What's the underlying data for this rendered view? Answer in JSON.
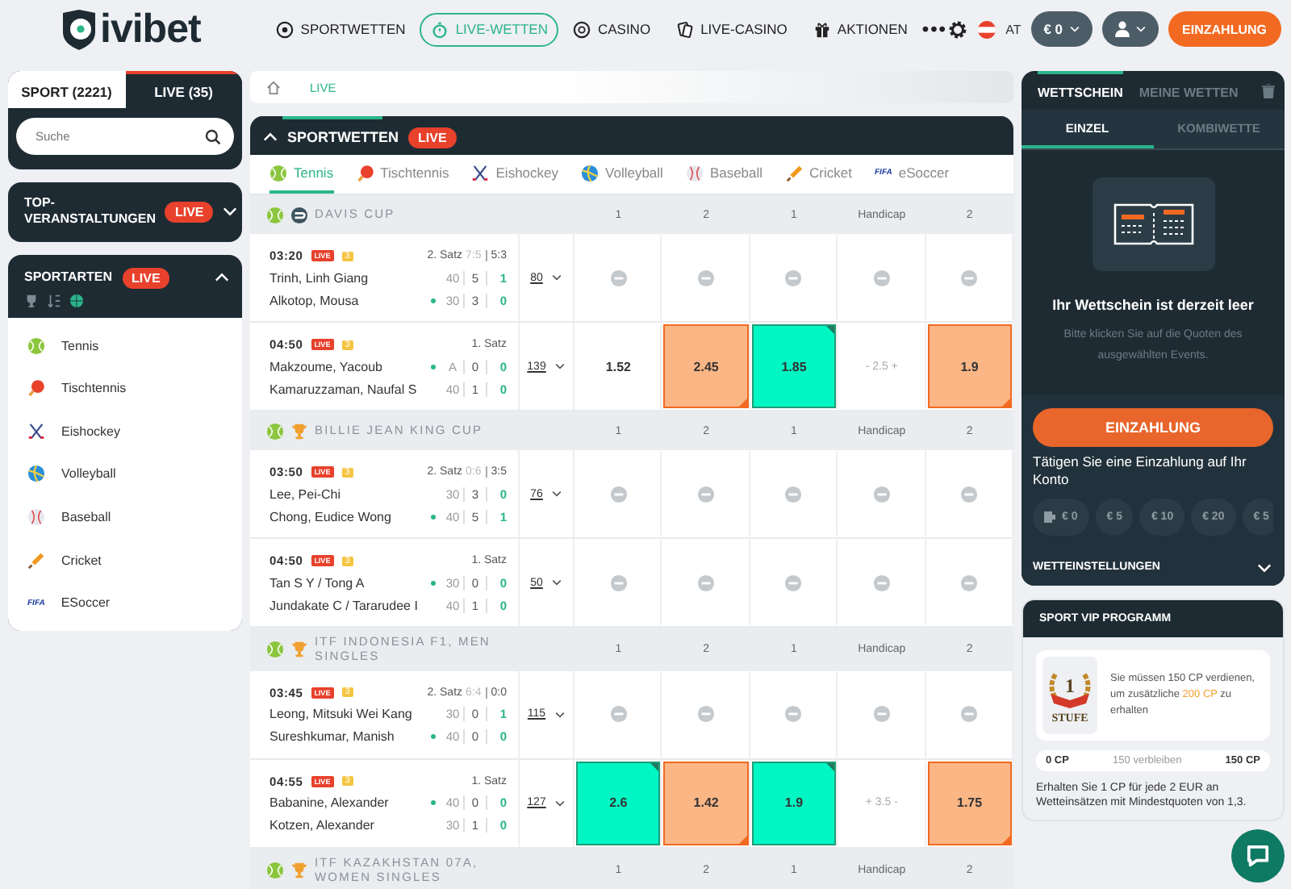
{
  "header": {
    "logo": "ivibet",
    "nav": [
      {
        "label": "SPORTWETTEN",
        "kind": "ball",
        "selected": false
      },
      {
        "label": "LIVE-WETTEN",
        "kind": "live",
        "selected": true
      },
      {
        "label": "CASINO",
        "kind": "chip",
        "selected": false
      },
      {
        "label": "LIVE-CASINO",
        "kind": "cards",
        "selected": false
      },
      {
        "label": "AKTIONEN",
        "kind": "gift",
        "selected": false
      }
    ],
    "more": "•••",
    "country": "AT",
    "balance": "€ 0",
    "deposit": "EINZAHLUNG"
  },
  "left": {
    "tabs": [
      {
        "label": "SPORT (2221)",
        "selected": false
      },
      {
        "label": "LIVE (35)",
        "selected": true
      }
    ],
    "search": {
      "placeholder": "Suche"
    },
    "top_events": {
      "title": "TOP-VERANSTALTUNGEN",
      "badge": "LIVE",
      "expanded": false
    },
    "sports": {
      "title": "SPORTARTEN",
      "badge": "LIVE",
      "expanded": true,
      "items": [
        {
          "label": "Tennis",
          "kind": "tennis"
        },
        {
          "label": "Tischtennis",
          "kind": "tabletennis"
        },
        {
          "label": "Eishockey",
          "kind": "hockey"
        },
        {
          "label": "Volleyball",
          "kind": "volleyball"
        },
        {
          "label": "Baseball",
          "kind": "baseball"
        },
        {
          "label": "Cricket",
          "kind": "cricket"
        },
        {
          "label": "ESoccer",
          "kind": "esoccer",
          "logo": "FIFA"
        }
      ]
    }
  },
  "breadcrumb": [
    "LIVE"
  ],
  "main": {
    "title": "SPORTWETTEN",
    "badge": "LIVE",
    "expanded": true,
    "tabs": [
      {
        "label": "Tennis",
        "kind": "tennis",
        "selected": true
      },
      {
        "label": "Tischtennis",
        "kind": "tabletennis",
        "selected": false
      },
      {
        "label": "Eishockey",
        "kind": "hockey",
        "selected": false
      },
      {
        "label": "Volleyball",
        "kind": "volleyball",
        "selected": false
      },
      {
        "label": "Baseball",
        "kind": "baseball",
        "selected": false
      },
      {
        "label": "Cricket",
        "kind": "cricket",
        "selected": false
      },
      {
        "label": "eSoccer",
        "kind": "esoccer",
        "logo": "FIFA",
        "selected": false
      }
    ],
    "leagues": [
      {
        "name": "DAVIS CUP",
        "kind": "round",
        "columns": [
          "1",
          "2",
          "1",
          "Handicap",
          "2"
        ],
        "matches": [
          {
            "time": "03:20",
            "live": "LIVE",
            "set_badge": "3",
            "period": "2. Satz",
            "previous_sets": "7:5",
            "current_set": "5:3",
            "markets": "80",
            "players": [
              {
                "name": "Trinh, Linh Giang",
                "serving": false,
                "points": "40",
                "games": "5",
                "sets": "1"
              },
              {
                "name": "Alkotop, Mousa",
                "serving": true,
                "points": "30",
                "games": "3",
                "sets": "0"
              }
            ],
            "odds": [
              {
                "kind": "locked"
              },
              {
                "kind": "locked"
              },
              {
                "kind": "locked"
              },
              {
                "kind": "locked"
              },
              {
                "kind": "locked"
              }
            ]
          },
          {
            "time": "04:50",
            "live": "LIVE",
            "set_badge": "3",
            "period": "1. Satz",
            "markets": "139",
            "players": [
              {
                "name": "Makzoume, Yacoub",
                "serving": true,
                "points": "A",
                "games": "0",
                "sets": "0"
              },
              {
                "name": "Kamaruzzaman, Naufal S",
                "serving": false,
                "points": "40",
                "games": "1",
                "sets": "0"
              }
            ],
            "odds": [
              {
                "kind": "odds",
                "value": "1.52",
                "rising": false,
                "falling": false
              },
              {
                "kind": "odds",
                "value": "2.45",
                "rising": false,
                "falling": true
              },
              {
                "kind": "odds",
                "value": "1.85",
                "rising": true,
                "falling": false
              },
              {
                "kind": "handicap",
                "value": "- 2.5 +"
              },
              {
                "kind": "odds",
                "value": "1.9",
                "rising": false,
                "falling": true
              }
            ]
          }
        ]
      },
      {
        "name": "BILLIE JEAN KING CUP",
        "kind": "trophy",
        "columns": [
          "1",
          "2",
          "1",
          "Handicap",
          "2"
        ],
        "matches": [
          {
            "time": "03:50",
            "live": "LIVE",
            "set_badge": "3",
            "period": "2. Satz",
            "previous_sets": "0:6",
            "current_set": "3:5",
            "markets": "76",
            "players": [
              {
                "name": "Lee, Pei-Chi",
                "serving": false,
                "points": "30",
                "games": "3",
                "sets": "0"
              },
              {
                "name": "Chong, Eudice Wong",
                "serving": true,
                "points": "40",
                "games": "5",
                "sets": "1"
              }
            ],
            "odds": [
              {
                "kind": "locked"
              },
              {
                "kind": "locked"
              },
              {
                "kind": "locked"
              },
              {
                "kind": "locked"
              },
              {
                "kind": "locked"
              }
            ]
          },
          {
            "time": "04:50",
            "live": "LIVE",
            "set_badge": "3",
            "period": "1. Satz",
            "markets": "50",
            "players": [
              {
                "name": "Tan S Y / Tong A",
                "serving": true,
                "points": "30",
                "games": "0",
                "sets": "0"
              },
              {
                "name": "Jundakate C / Tararudee I",
                "serving": false,
                "points": "40",
                "games": "1",
                "sets": "0"
              }
            ],
            "odds": [
              {
                "kind": "locked"
              },
              {
                "kind": "locked"
              },
              {
                "kind": "locked"
              },
              {
                "kind": "locked"
              },
              {
                "kind": "locked"
              }
            ]
          }
        ]
      },
      {
        "name": "ITF INDONESIA F1, MEN SINGLES",
        "kind": "trophy",
        "columns": [
          "1",
          "2",
          "1",
          "Handicap",
          "2"
        ],
        "matches": [
          {
            "time": "03:45",
            "live": "LIVE",
            "set_badge": "3",
            "period": "2. Satz",
            "previous_sets": "6:4",
            "current_set": "0:0",
            "markets": "115",
            "players": [
              {
                "name": "Leong, Mitsuki Wei Kang",
                "serving": false,
                "points": "30",
                "games": "0",
                "sets": "1"
              },
              {
                "name": "Sureshkumar, Manish",
                "serving": true,
                "points": "40",
                "games": "0",
                "sets": "0"
              }
            ],
            "odds": [
              {
                "kind": "locked"
              },
              {
                "kind": "locked"
              },
              {
                "kind": "locked"
              },
              {
                "kind": "locked"
              },
              {
                "kind": "locked"
              }
            ]
          },
          {
            "time": "04:55",
            "live": "LIVE",
            "set_badge": "3",
            "period": "1. Satz",
            "markets": "127",
            "players": [
              {
                "name": "Babanine, Alexander",
                "serving": true,
                "points": "40",
                "games": "0",
                "sets": "0"
              },
              {
                "name": "Kotzen, Alexander",
                "serving": false,
                "points": "30",
                "games": "1",
                "sets": "0"
              }
            ],
            "odds": [
              {
                "kind": "odds",
                "value": "2.6",
                "rising": true,
                "falling": false
              },
              {
                "kind": "odds",
                "value": "1.42",
                "rising": false,
                "falling": true
              },
              {
                "kind": "odds",
                "value": "1.9",
                "rising": true,
                "falling": false
              },
              {
                "kind": "handicap",
                "value": "+ 3.5 -"
              },
              {
                "kind": "odds",
                "value": "1.75",
                "rising": false,
                "falling": true
              }
            ]
          }
        ]
      },
      {
        "name": "ITF KAZAKHSTAN 07A, WOMEN SINGLES",
        "kind": "trophy",
        "columns": [
          "1",
          "2",
          "1",
          "Handicap",
          "2"
        ]
      }
    ]
  },
  "betslip": {
    "tabs": [
      {
        "label": "WETTSCHEIN",
        "selected": true
      },
      {
        "label": "MEINE WETTEN",
        "selected": false
      }
    ],
    "modes": [
      {
        "label": "EINZEL",
        "selected": true
      },
      {
        "label": "KOMBIWETTE",
        "selected": false
      }
    ],
    "empty_title": "Ihr Wettschein ist derzeit leer",
    "empty_text": "Bitte klicken Sie auf die Quoten des ausgewählten Events.",
    "deposit": "EINZAHLUNG",
    "deposit_text": "Tätigen Sie eine Einzahlung auf Ihr Konto",
    "balance_chip": "€ 0",
    "amounts": [
      "€ 5",
      "€ 10",
      "€ 20",
      "€ 5"
    ],
    "settings": "WETTEINSTELLUNGEN"
  },
  "vip": {
    "title": "SPORT VIP PROGRAMM",
    "level": "1",
    "level_label": "STUFE",
    "text": "Sie müssen 150 CP verdienen, um zusätzliche **200 CP** zu erhalten",
    "progress": {
      "start": "0 CP",
      "remaining": "150 verbleiben",
      "end": "150 CP",
      "level": 0
    },
    "note": "Erhalten Sie 1 CP für jede 2 EUR an Wetteinsätzen mit Mindestquoten von 1,3."
  }
}
